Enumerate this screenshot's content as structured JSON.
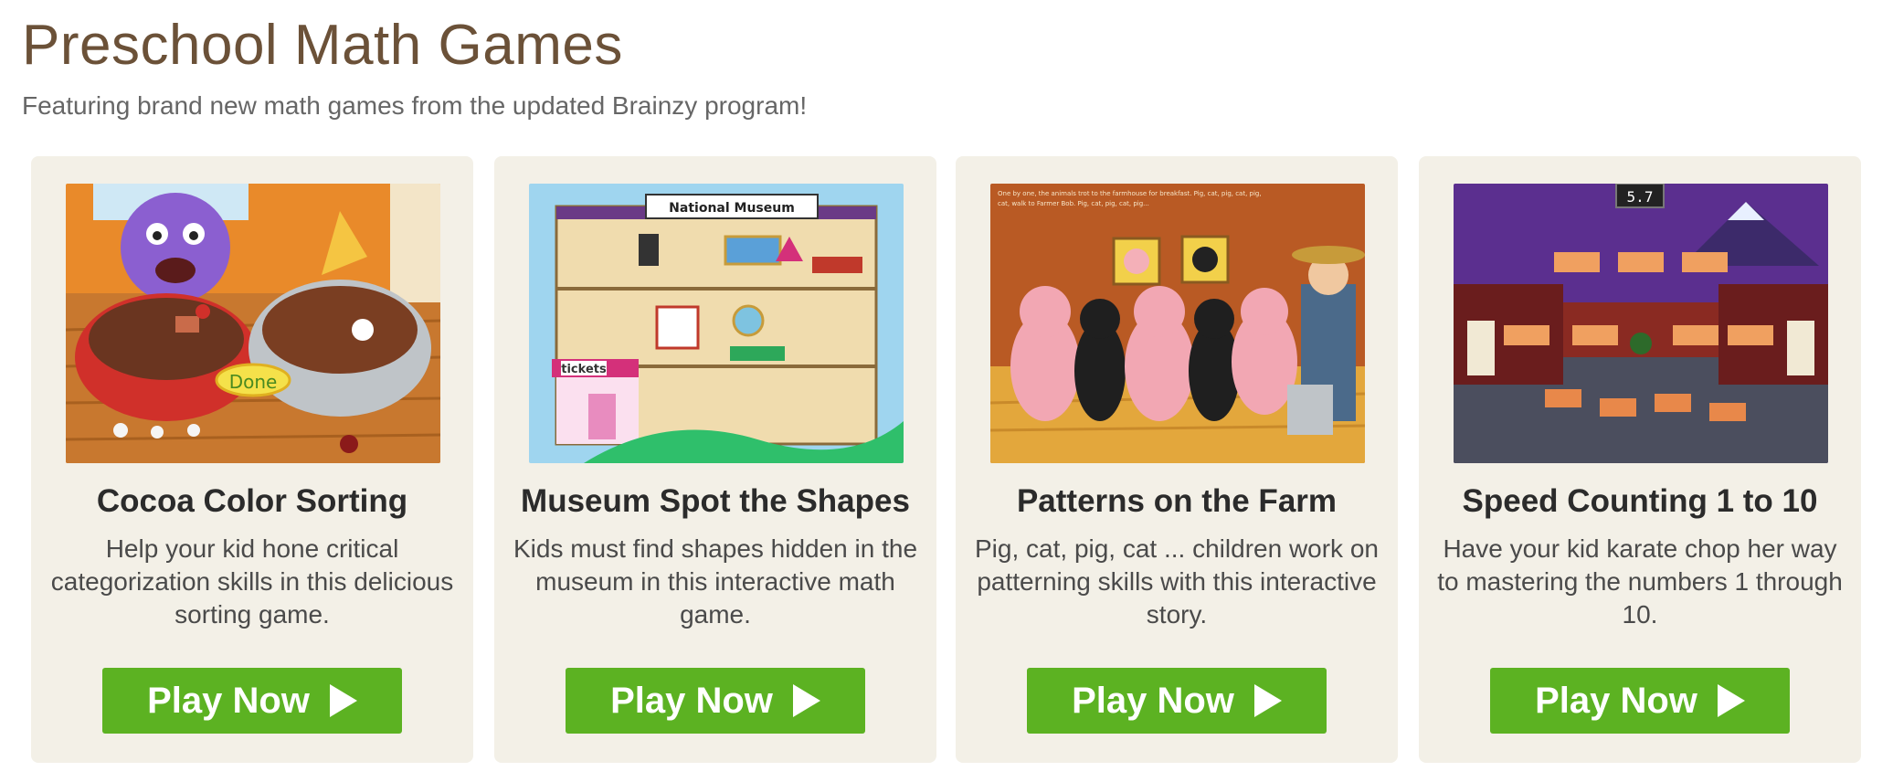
{
  "header": {
    "title": "Preschool Math Games",
    "subtitle": "Featuring brand new math games from the updated Brainzy program!"
  },
  "cards": [
    {
      "title": "Cocoa Color Sorting",
      "description": "Help your kid hone critical categorization skills in this delicious sorting game.",
      "button_label": "Play Now",
      "image_label": "Done"
    },
    {
      "title": "Museum Spot the Shapes",
      "description": "Kids must find shapes hidden in the museum in this interactive math game.",
      "button_label": "Play Now",
      "image_label": "National Museum",
      "image_label2": "tickets"
    },
    {
      "title": "Patterns on the Farm",
      "description": "Pig, cat, pig, cat ... children work on patterning skills with this interactive story.",
      "button_label": "Play Now",
      "image_text": "One by one, the animals trot to the farmhouse for breakfast. Pig, cat, pig, cat, pig, cat, walk to Farmer Bob. Pig, cat, pig, cat, pig..."
    },
    {
      "title": "Speed Counting 1 to 10",
      "description": "Have your kid karate chop her way to mastering the numbers 1 through 10.",
      "button_label": "Play Now",
      "image_timer": "5.7"
    }
  ],
  "colors": {
    "title": "#6b5138",
    "card_bg": "#f3f0e7",
    "button": "#5cb222"
  }
}
